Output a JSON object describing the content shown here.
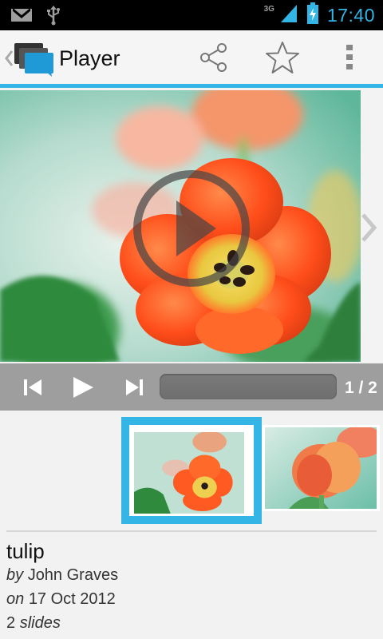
{
  "status_bar": {
    "time": "17:40",
    "network": "3G",
    "icons": [
      "gmail-icon",
      "usb-icon",
      "signal-icon",
      "battery-charging-icon"
    ]
  },
  "action_bar": {
    "title": "Player",
    "actions": [
      "share-icon",
      "star-icon",
      "overflow-menu-icon"
    ]
  },
  "player": {
    "media": "tulip-photo",
    "controls": [
      "skip-previous-icon",
      "play-icon",
      "skip-next-icon"
    ],
    "progress_fraction": 0.0,
    "counter": "1 / 2"
  },
  "thumbnails": [
    {
      "selected": true
    },
    {
      "selected": false
    }
  ],
  "info": {
    "title": "tulip",
    "by_label": "by",
    "author": "John Graves",
    "on_label": "on",
    "date": "17 Oct 2012",
    "slide_count": "2",
    "slides_label": "slides"
  },
  "colors": {
    "accent": "#33b5e5",
    "controls_bg": "#9e9e9e",
    "status_bg": "#000000"
  }
}
